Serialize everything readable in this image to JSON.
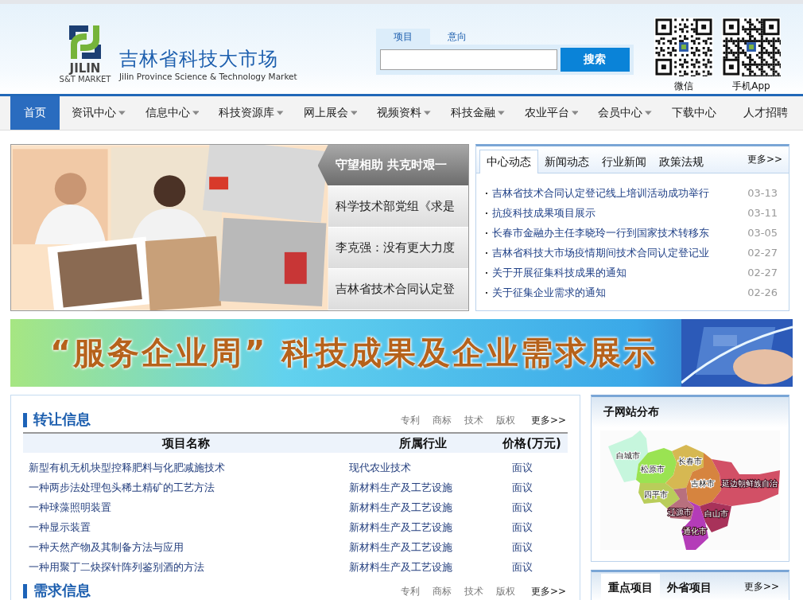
{
  "header": {
    "logo": {
      "mark_line1": "JILIN",
      "mark_line2": "S&T MARKET",
      "title": "吉林省科技大市场",
      "subtitle": "Jilin Province Science & Technology Market"
    },
    "search": {
      "tabs": [
        {
          "label": "项目",
          "selected": true
        },
        {
          "label": "意向",
          "selected": false
        }
      ],
      "button": "搜索"
    },
    "qr_codes": [
      {
        "caption": "微信"
      },
      {
        "caption": "手机App"
      }
    ]
  },
  "nav": [
    {
      "label": "首页",
      "selected": true,
      "dropdown": false
    },
    {
      "label": "资讯中心",
      "selected": false,
      "dropdown": true
    },
    {
      "label": "信息中心",
      "selected": false,
      "dropdown": true
    },
    {
      "label": "科技资源库",
      "selected": false,
      "dropdown": true
    },
    {
      "label": "网上展会",
      "selected": false,
      "dropdown": true
    },
    {
      "label": "视频资料",
      "selected": false,
      "dropdown": true
    },
    {
      "label": "科技金融",
      "selected": false,
      "dropdown": true
    },
    {
      "label": "农业平台",
      "selected": false,
      "dropdown": true
    },
    {
      "label": "会员中心",
      "selected": false,
      "dropdown": true
    },
    {
      "label": "下载中心",
      "selected": false,
      "dropdown": false
    },
    {
      "label": "人才招聘",
      "selected": false,
      "dropdown": false
    }
  ],
  "slider": {
    "captions": [
      {
        "text": "守望相助 共克时艰一",
        "selected": true
      },
      {
        "text": "科学技术部党组《求是",
        "selected": false
      },
      {
        "text": "李克强：没有更大力度",
        "selected": false
      },
      {
        "text": "吉林省技术合同认定登",
        "selected": false
      }
    ]
  },
  "news": {
    "tabs": [
      {
        "label": "中心动态",
        "selected": true
      },
      {
        "label": "新闻动态",
        "selected": false
      },
      {
        "label": "行业新闻",
        "selected": false
      },
      {
        "label": "政策法规",
        "selected": false
      }
    ],
    "more": "更多>>",
    "items": [
      {
        "title": "吉林省技术合同认定登记线上培训活动成功举行",
        "date": "03-13"
      },
      {
        "title": "抗疫科技成果项目展示",
        "date": "03-11"
      },
      {
        "title": "长春市金融办主任李晓玲一行到国家技术转移东",
        "date": "03-05"
      },
      {
        "title": "吉林省科技大市场疫情期间技术合同认定登记业",
        "date": "02-27"
      },
      {
        "title": "关于开展征集科技成果的通知",
        "date": "02-27"
      },
      {
        "title": "关于征集企业需求的通知",
        "date": "02-26"
      }
    ]
  },
  "banner": {
    "title": "“服务企业周” 科技成果及企业需求展示"
  },
  "transfer": {
    "title": "转让信息",
    "filters": [
      "专利",
      "商标",
      "技术",
      "版权"
    ],
    "more": "更多>>",
    "columns": [
      "项目名称",
      "所属行业",
      "价格(万元)"
    ],
    "rows": [
      [
        "新型有机无机块型控释肥料与化肥减施技术",
        "现代农业技术",
        "面议"
      ],
      [
        "一种两步法处理包头稀土精矿的工艺方法",
        "新材料生产及工艺设施",
        "面议"
      ],
      [
        "一种球藻照明装置",
        "新材料生产及工艺设施",
        "面议"
      ],
      [
        "一种显示装置",
        "新材料生产及工艺设施",
        "面议"
      ],
      [
        "一种天然产物及其制备方法与应用",
        "新材料生产及工艺设施",
        "面议"
      ],
      [
        "一种用聚丁二炔探针阵列鉴别酒的方法",
        "新材料生产及工艺设施",
        "面议"
      ]
    ]
  },
  "demand": {
    "title": "需求信息",
    "filters": [
      "专利",
      "商标",
      "技术",
      "版权"
    ],
    "more": "更多>>"
  },
  "subsites": {
    "title": "子网站分布",
    "map": {
      "regions": [
        {
          "name": "白城市",
          "color": "#c6f6dd"
        },
        {
          "name": "松原市",
          "color": "#9ae352"
        },
        {
          "name": "长春市",
          "color": "#d6b852"
        },
        {
          "name": "吉林市",
          "color": "#d6843f"
        },
        {
          "name": "延边朝鲜族自治",
          "color": "#d25066"
        },
        {
          "name": "四平市",
          "color": "#b9cd5a"
        },
        {
          "name": "辽源市",
          "color": "#b8707e"
        },
        {
          "name": "白山市",
          "color": "#a8325a"
        },
        {
          "name": "通化市",
          "color": "#b43cb8"
        }
      ]
    }
  },
  "projects": {
    "tabs": [
      {
        "label": "重点项目",
        "selected": true
      },
      {
        "label": "外省项目",
        "selected": false
      }
    ],
    "more": "更多>>"
  }
}
